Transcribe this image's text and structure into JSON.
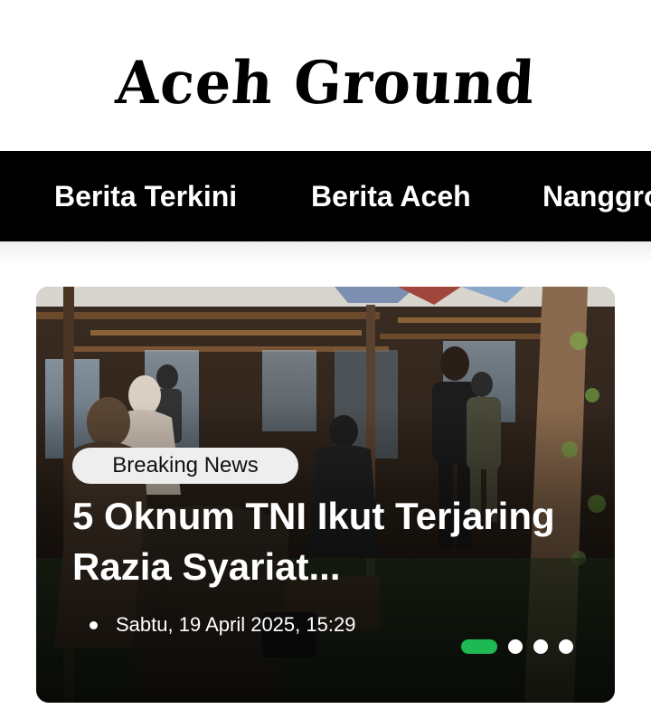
{
  "site": {
    "logo_text": "Aceh Ground"
  },
  "nav": {
    "items": [
      {
        "label": "Berita Terkini"
      },
      {
        "label": "Berita Aceh"
      },
      {
        "label": "Nanggroe"
      }
    ]
  },
  "featured": {
    "badge": "Breaking News",
    "headline": "5 Oknum TNI Ikut Terjaring Razia Syariat...",
    "date": "Sabtu, 19 April 2025, 15:29",
    "carousel": {
      "total": 4,
      "active_index": 0,
      "active_color": "#1db954"
    }
  },
  "colors": {
    "nav_background": "#000000",
    "nav_text": "#ffffff",
    "badge_background": "#eeeeee",
    "accent": "#1db954"
  }
}
